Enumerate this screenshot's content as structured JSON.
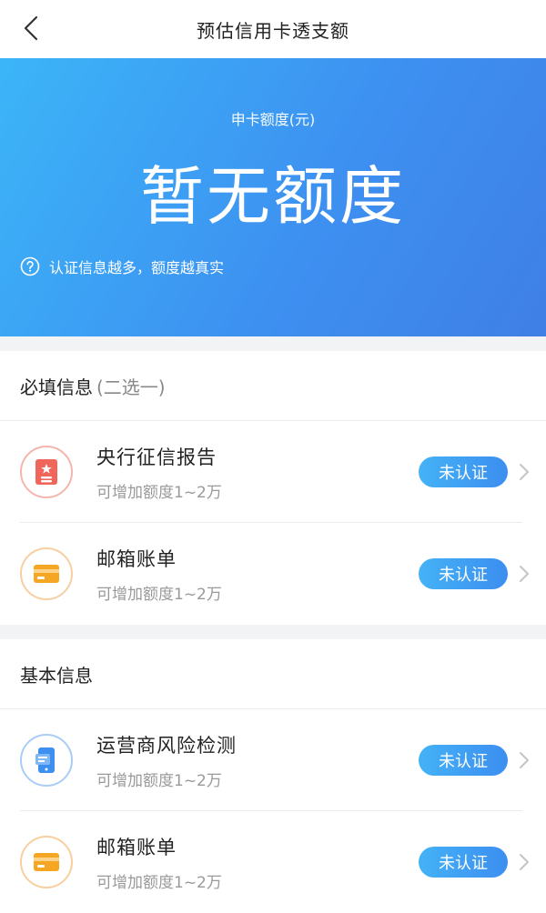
{
  "nav": {
    "title": "预估信用卡透支额"
  },
  "hero": {
    "subtitle": "申卡额度(元)",
    "amount": "暂无额度",
    "hint": "认证信息越多，额度越真实"
  },
  "required": {
    "title": "必填信息",
    "note": "(二选一)",
    "items": [
      {
        "title": "央行征信报告",
        "desc": "可增加额度1~2万",
        "status": "未认证",
        "icon": "credit-report-icon"
      },
      {
        "title": "邮箱账单",
        "desc": "可增加额度1~2万",
        "status": "未认证",
        "icon": "email-bill-card-icon"
      }
    ]
  },
  "basic": {
    "title": "基本信息",
    "items": [
      {
        "title": "运营商风险检测",
        "desc": "可增加额度1~2万",
        "status": "未认证",
        "icon": "carrier-phone-icon"
      },
      {
        "title": "邮箱账单",
        "desc": "可增加额度1~2万",
        "status": "未认证",
        "icon": "email-bill-card-icon"
      }
    ]
  },
  "colors": {
    "accent_start": "#3cb5f8",
    "accent_end": "#3f7fe6",
    "red_icon": "#f0665a",
    "orange_icon": "#f5a623",
    "blue_icon": "#3d8ff0"
  }
}
